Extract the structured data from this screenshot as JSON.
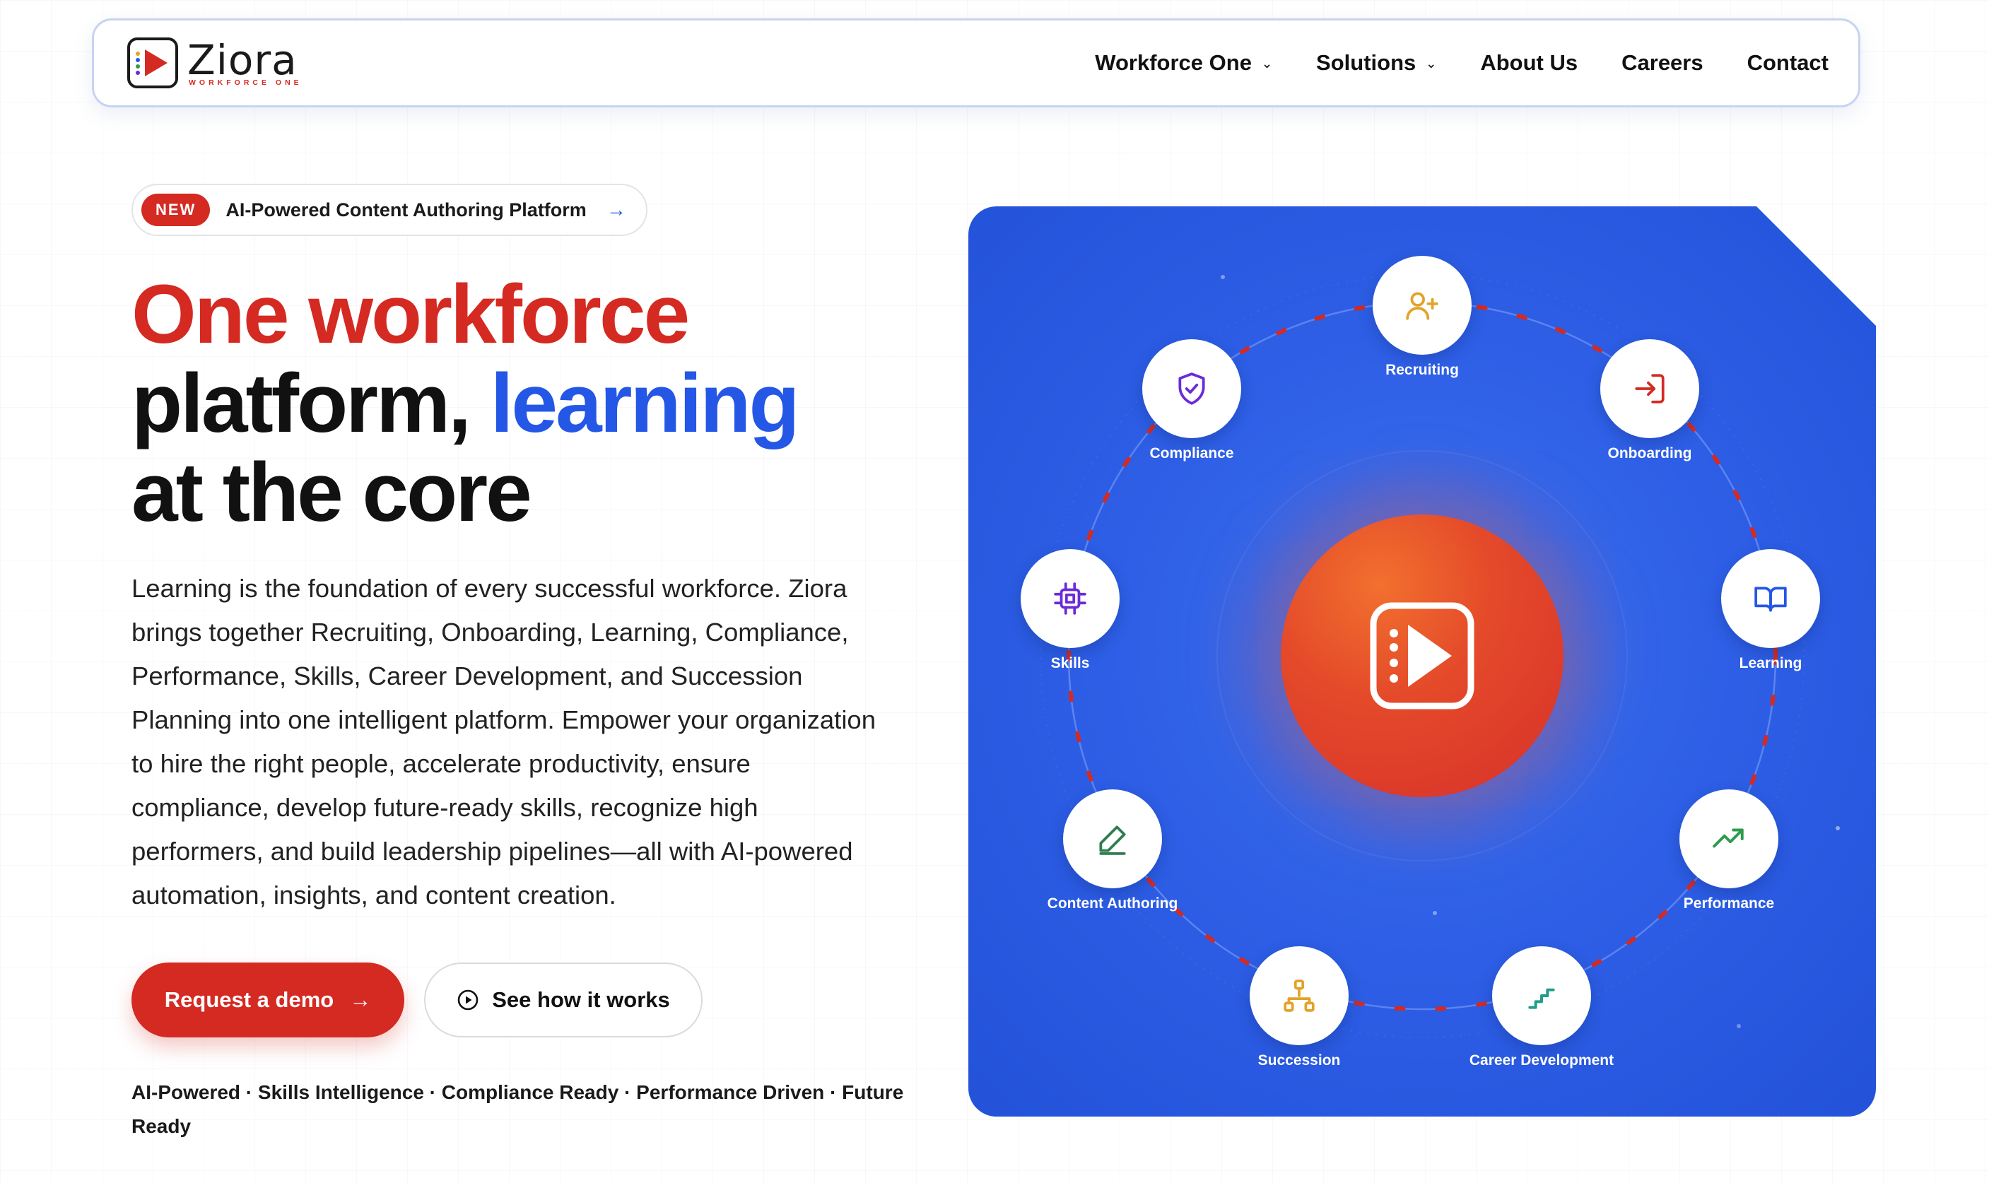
{
  "brand": {
    "name": "Ziora",
    "subtitle": "WORKFORCE ONE"
  },
  "nav": {
    "items": [
      {
        "label": "Workforce One",
        "has_dropdown": true
      },
      {
        "label": "Solutions",
        "has_dropdown": true
      },
      {
        "label": "About Us",
        "has_dropdown": false
      },
      {
        "label": "Careers",
        "has_dropdown": false
      },
      {
        "label": "Contact",
        "has_dropdown": false
      }
    ]
  },
  "badge": {
    "tag": "NEW",
    "text": "AI-Powered Content Authoring Platform"
  },
  "hero": {
    "title_line1": "One workforce",
    "title_line2_a": "platform, ",
    "title_line2_b": "learning",
    "title_line3": "at the core",
    "description": "Learning is the foundation of every successful workforce. Ziora brings together Recruiting, Onboarding, Learning, Compliance, Performance, Skills, Career Development, and Succession Planning into one intelligent platform. Empower your organization to hire the right people, accelerate productivity, ensure compliance, develop future-ready skills, recognize high performers, and build leadership pipelines—all with AI-powered automation, insights, and content creation.",
    "primary_cta": "Request a demo",
    "secondary_cta": "See how it works",
    "tagline": "AI-Powered · Skills Intelligence · Compliance Ready · Performance Driven · Future Ready"
  },
  "modules": [
    {
      "label": "Recruiting",
      "icon": "user-plus-icon",
      "color": "#e2a329"
    },
    {
      "label": "Onboarding",
      "icon": "login-icon",
      "color": "#d42a22"
    },
    {
      "label": "Learning",
      "icon": "book-open-icon",
      "color": "#2557e6"
    },
    {
      "label": "Performance",
      "icon": "trending-up-icon",
      "color": "#2e9b4e"
    },
    {
      "label": "Career Development",
      "icon": "stairs-icon",
      "color": "#1f9d8a"
    },
    {
      "label": "Succession",
      "icon": "hierarchy-icon",
      "color": "#e2a329"
    },
    {
      "label": "Content Authoring",
      "icon": "pen-icon",
      "color": "#2e7d4e"
    },
    {
      "label": "Skills",
      "icon": "chip-icon",
      "color": "#6a2bd9"
    },
    {
      "label": "Compliance",
      "icon": "shield-check-icon",
      "color": "#6a2bd9"
    }
  ],
  "colors": {
    "brand_red": "#d42a22",
    "accent_blue": "#2557e6",
    "panel_blue": "#2e5fe6"
  }
}
